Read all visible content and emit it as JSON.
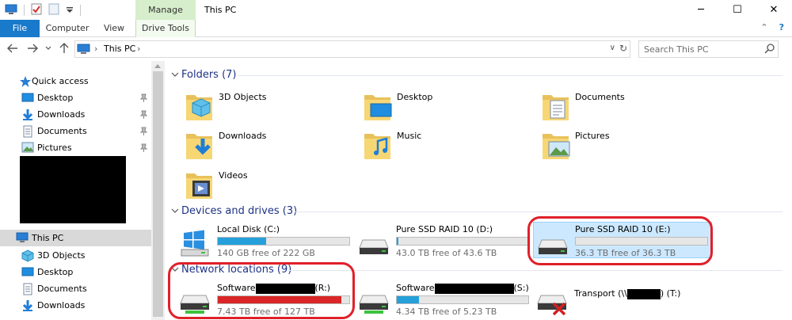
{
  "titlebar": {
    "manage_tab": "Manage",
    "title": "This PC",
    "minimize": "─",
    "maximize": "☐",
    "close": "✕"
  },
  "ribbon": {
    "tabs": [
      "File",
      "Computer",
      "View",
      "Drive Tools"
    ],
    "collapse": "⌃",
    "help": "?"
  },
  "address": {
    "separator": "›",
    "crumb": "This PC",
    "dropdown": "∨",
    "refresh": "↻",
    "search_placeholder": "Search This PC"
  },
  "nav": {
    "quick_access": "Quick access",
    "quick_items": [
      "Desktop",
      "Downloads",
      "Documents",
      "Pictures"
    ],
    "this_pc": "This PC",
    "pc_items": [
      "3D Objects",
      "Desktop",
      "Documents",
      "Downloads"
    ]
  },
  "groups": {
    "folders": "Folders (7)",
    "devices": "Devices and drives (3)",
    "network": "Network locations (9)"
  },
  "folders": [
    "3D Objects",
    "Desktop",
    "Documents",
    "Downloads",
    "Music",
    "Pictures",
    "Videos"
  ],
  "drives": [
    {
      "name": "Local Disk (C:)",
      "free": "140 GB free of 222 GB",
      "used_fraction": 0.37
    },
    {
      "name": "Pure SSD RAID 10 (D:)",
      "free": "43.0 TB free of 43.6 TB",
      "used_fraction": 0.014
    },
    {
      "name": "Pure SSD RAID 10 (E:)",
      "free": "36.3 TB free of 36.3 TB",
      "used_fraction": 0.0
    }
  ],
  "network": [
    {
      "name_prefix": "Software",
      "name_suffix": "(R:)",
      "free": "7.43 TB free of 127 TB",
      "used_fraction": 0.94
    },
    {
      "name_prefix": "Software",
      "name_suffix": "(S:)",
      "free": "4.34 TB free of 5.23 TB",
      "used_fraction": 0.17
    },
    {
      "name_prefix": "Transport (\\\\",
      "name_suffix": ") (T:)"
    }
  ],
  "colors": {
    "accent": "#1979ca",
    "manage": "#d6eecb",
    "group_header": "#1e3287",
    "bar_blue": "#26a0da",
    "bar_red": "#da2626",
    "selected": "#cce8ff",
    "annotation": "#e0202a"
  }
}
